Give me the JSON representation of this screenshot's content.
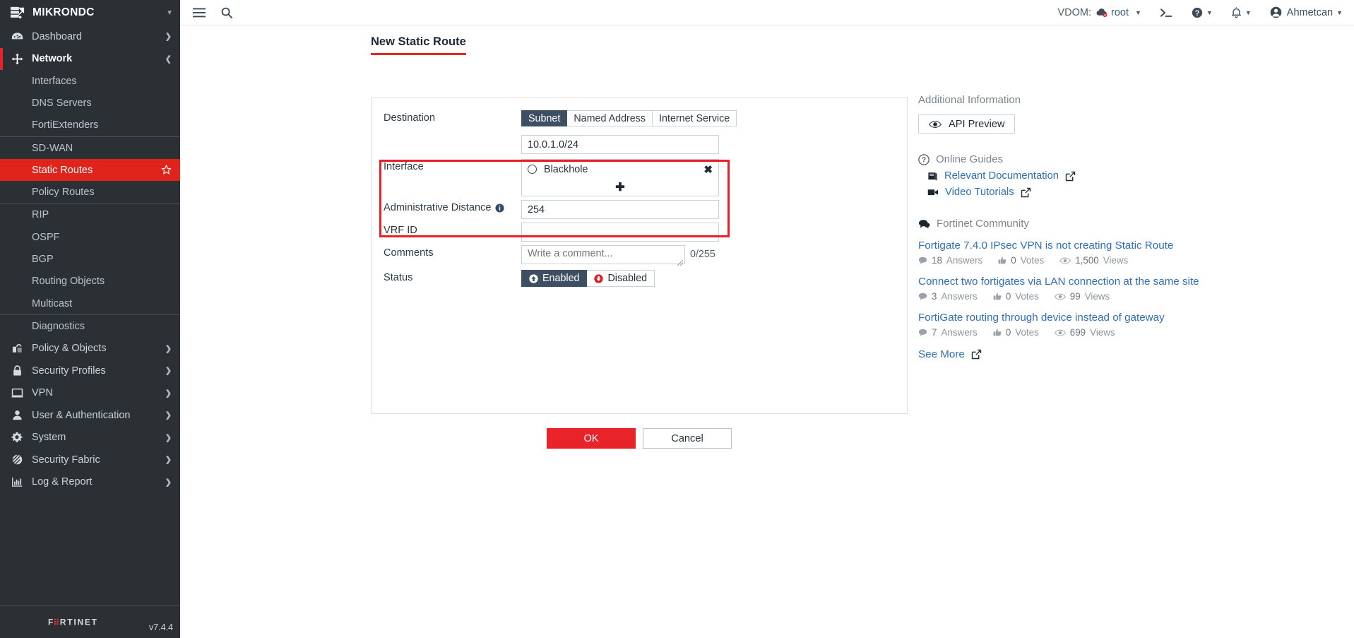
{
  "sidebar": {
    "brand": {
      "name": "MIKRONDC",
      "logo_icon": "fortigate-device-icon",
      "caret_icon": "chevron-down-icon"
    },
    "items": [
      {
        "label": "Dashboard",
        "icon": "dashboard-gauge-icon",
        "chevron": "chevron-right-icon",
        "state": "collapsed"
      },
      {
        "label": "Network",
        "icon": "network-arrows-icon",
        "chevron": "chevron-down-icon",
        "state": "expanded"
      }
    ],
    "network_children": [
      {
        "label": "Interfaces",
        "selected": false
      },
      {
        "label": "DNS Servers",
        "selected": false
      },
      {
        "label": "FortiExtenders",
        "selected": false
      },
      {
        "label": "SD-WAN",
        "selected": false
      },
      {
        "label": "Static Routes",
        "selected": true,
        "star_icon": "star-outline-icon"
      },
      {
        "label": "Policy Routes",
        "selected": false
      },
      {
        "label": "RIP",
        "selected": false
      },
      {
        "label": "OSPF",
        "selected": false
      },
      {
        "label": "BGP",
        "selected": false
      },
      {
        "label": "Routing Objects",
        "selected": false
      },
      {
        "label": "Multicast",
        "selected": false
      },
      {
        "label": "Diagnostics",
        "selected": false
      }
    ],
    "bottom_items": [
      {
        "label": "Policy & Objects",
        "icon": "policy-objects-icon",
        "chevron": "chevron-right-icon"
      },
      {
        "label": "Security Profiles",
        "icon": "lock-icon",
        "chevron": "chevron-right-icon"
      },
      {
        "label": "VPN",
        "icon": "monitor-icon",
        "chevron": "chevron-right-icon"
      },
      {
        "label": "User & Authentication",
        "icon": "user-icon",
        "chevron": "chevron-right-icon"
      },
      {
        "label": "System",
        "icon": "gear-icon",
        "chevron": "chevron-right-icon"
      },
      {
        "label": "Security Fabric",
        "icon": "security-fabric-icon",
        "chevron": "chevron-right-icon"
      },
      {
        "label": "Log & Report",
        "icon": "bar-chart-icon",
        "chevron": "chevron-right-icon"
      }
    ],
    "footer": {
      "logo_text": "FORTINET",
      "version": "v7.4.4"
    }
  },
  "topbar": {
    "menu_icon": "hamburger-menu-icon",
    "search_icon": "search-icon",
    "vdom_label": "VDOM:",
    "vdom_value": "root",
    "vdom_icon": "vdom-cloud-icon",
    "cli_icon": "cli-console-icon",
    "help_icon": "help-question-icon",
    "notification_icon": "bell-icon",
    "user_icon": "user-avatar-icon",
    "user_name": "Ahmetcan",
    "caret_icon": "caret-down-icon"
  },
  "page": {
    "title": "New Static Route"
  },
  "form": {
    "destination": {
      "label": "Destination",
      "tabs": [
        {
          "label": "Subnet",
          "active": true
        },
        {
          "label": "Named Address",
          "active": false
        },
        {
          "label": "Internet Service",
          "active": false
        }
      ]
    },
    "subnet": {
      "value": "10.0.1.0/24"
    },
    "interface": {
      "label": "Interface",
      "entries": [
        {
          "name": "Blackhole",
          "radio_icon": "radio-circle-icon",
          "remove_icon": "close-x-icon"
        }
      ],
      "add_icon": "plus-icon"
    },
    "admin_distance": {
      "label": "Administrative Distance",
      "info_icon": "info-circle-icon",
      "value": "254"
    },
    "vrf_id": {
      "label": "VRF ID",
      "value": ""
    },
    "comments": {
      "label": "Comments",
      "placeholder": "Write a comment...",
      "value": "",
      "counter": "0/255"
    },
    "status": {
      "label": "Status",
      "options": [
        {
          "label": "Enabled",
          "active": true,
          "icon": "arrow-up-circle-icon"
        },
        {
          "label": "Disabled",
          "active": false,
          "icon": "arrow-down-circle-icon"
        }
      ]
    },
    "buttons": {
      "ok": "OK",
      "cancel": "Cancel"
    }
  },
  "right_panel": {
    "heading": "Additional Information",
    "api_preview": {
      "label": "API Preview",
      "icon": "eye-icon"
    },
    "online_guides": {
      "title": "Online Guides",
      "icon": "question-circle-icon"
    },
    "guides": [
      {
        "label": "Relevant Documentation",
        "icon": "book-icon",
        "external_icon": "external-link-icon"
      },
      {
        "label": "Video Tutorials",
        "icon": "video-camera-icon",
        "external_icon": "external-link-icon"
      }
    ],
    "community": {
      "title": "Fortinet Community",
      "icon": "comments-icon"
    },
    "posts": [
      {
        "title": "Fortigate 7.4.0 IPsec VPN is not creating Static Route",
        "answers": "18",
        "answers_label": "Answers",
        "votes": "0",
        "votes_label": "Votes",
        "views": "1,500",
        "views_label": "Views"
      },
      {
        "title": "Connect two fortigates via LAN connection at the same site",
        "answers": "3",
        "answers_label": "Answers",
        "votes": "0",
        "votes_label": "Votes",
        "views": "99",
        "views_label": "Views"
      },
      {
        "title": "FortiGate routing through device instead of gateway",
        "answers": "7",
        "answers_label": "Answers",
        "votes": "0",
        "votes_label": "Votes",
        "views": "699",
        "views_label": "Views"
      }
    ],
    "see_more": {
      "label": "See More",
      "icon": "external-link-icon"
    }
  },
  "colors": {
    "sidebar_bg": "#2b3034",
    "accent_red": "#e8242a",
    "selected_red": "#e0241c",
    "annotation_red": "#ee1c25",
    "tab_active": "#3f4f63",
    "link_blue": "#2f6fb5"
  }
}
